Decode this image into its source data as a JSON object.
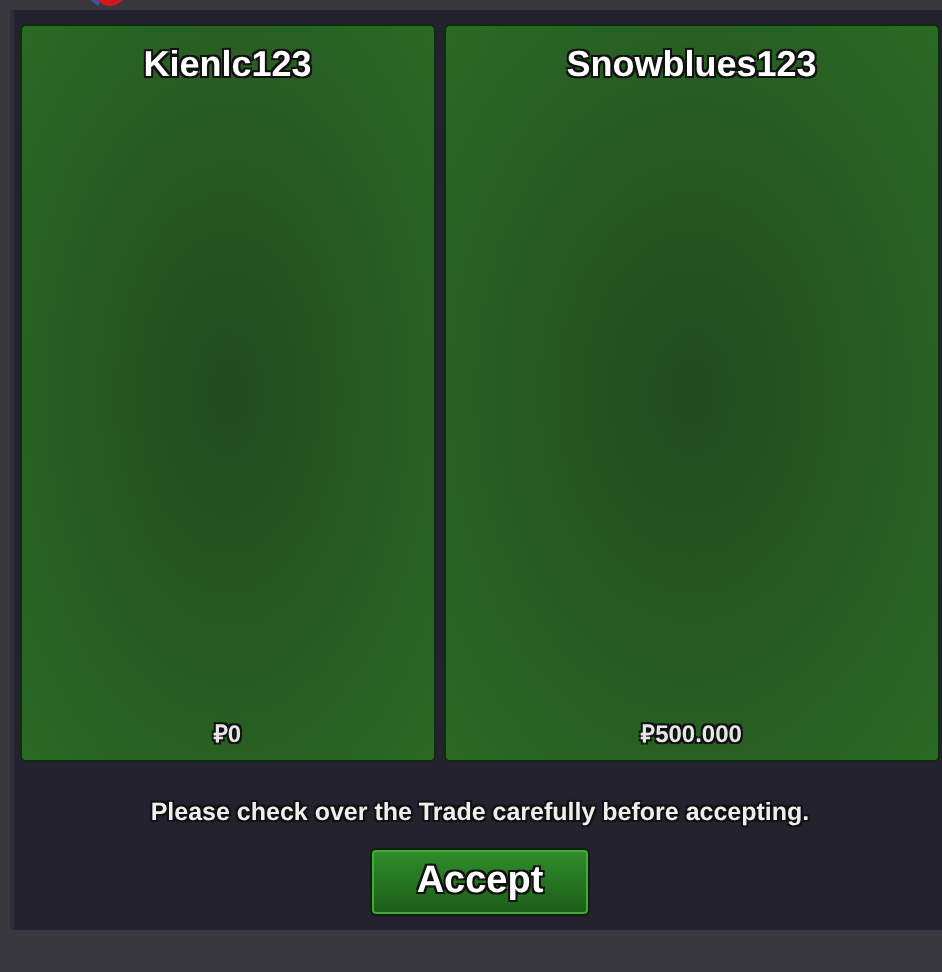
{
  "panels": [
    {
      "player": "Kienlc123",
      "money": "₽0"
    },
    {
      "player": "Snowblues123",
      "money": "₽500.000"
    }
  ],
  "notice": "Please check over the Trade carefully before accepting.",
  "buttons": [
    {
      "label": "Accept",
      "kind": "primary"
    }
  ]
}
